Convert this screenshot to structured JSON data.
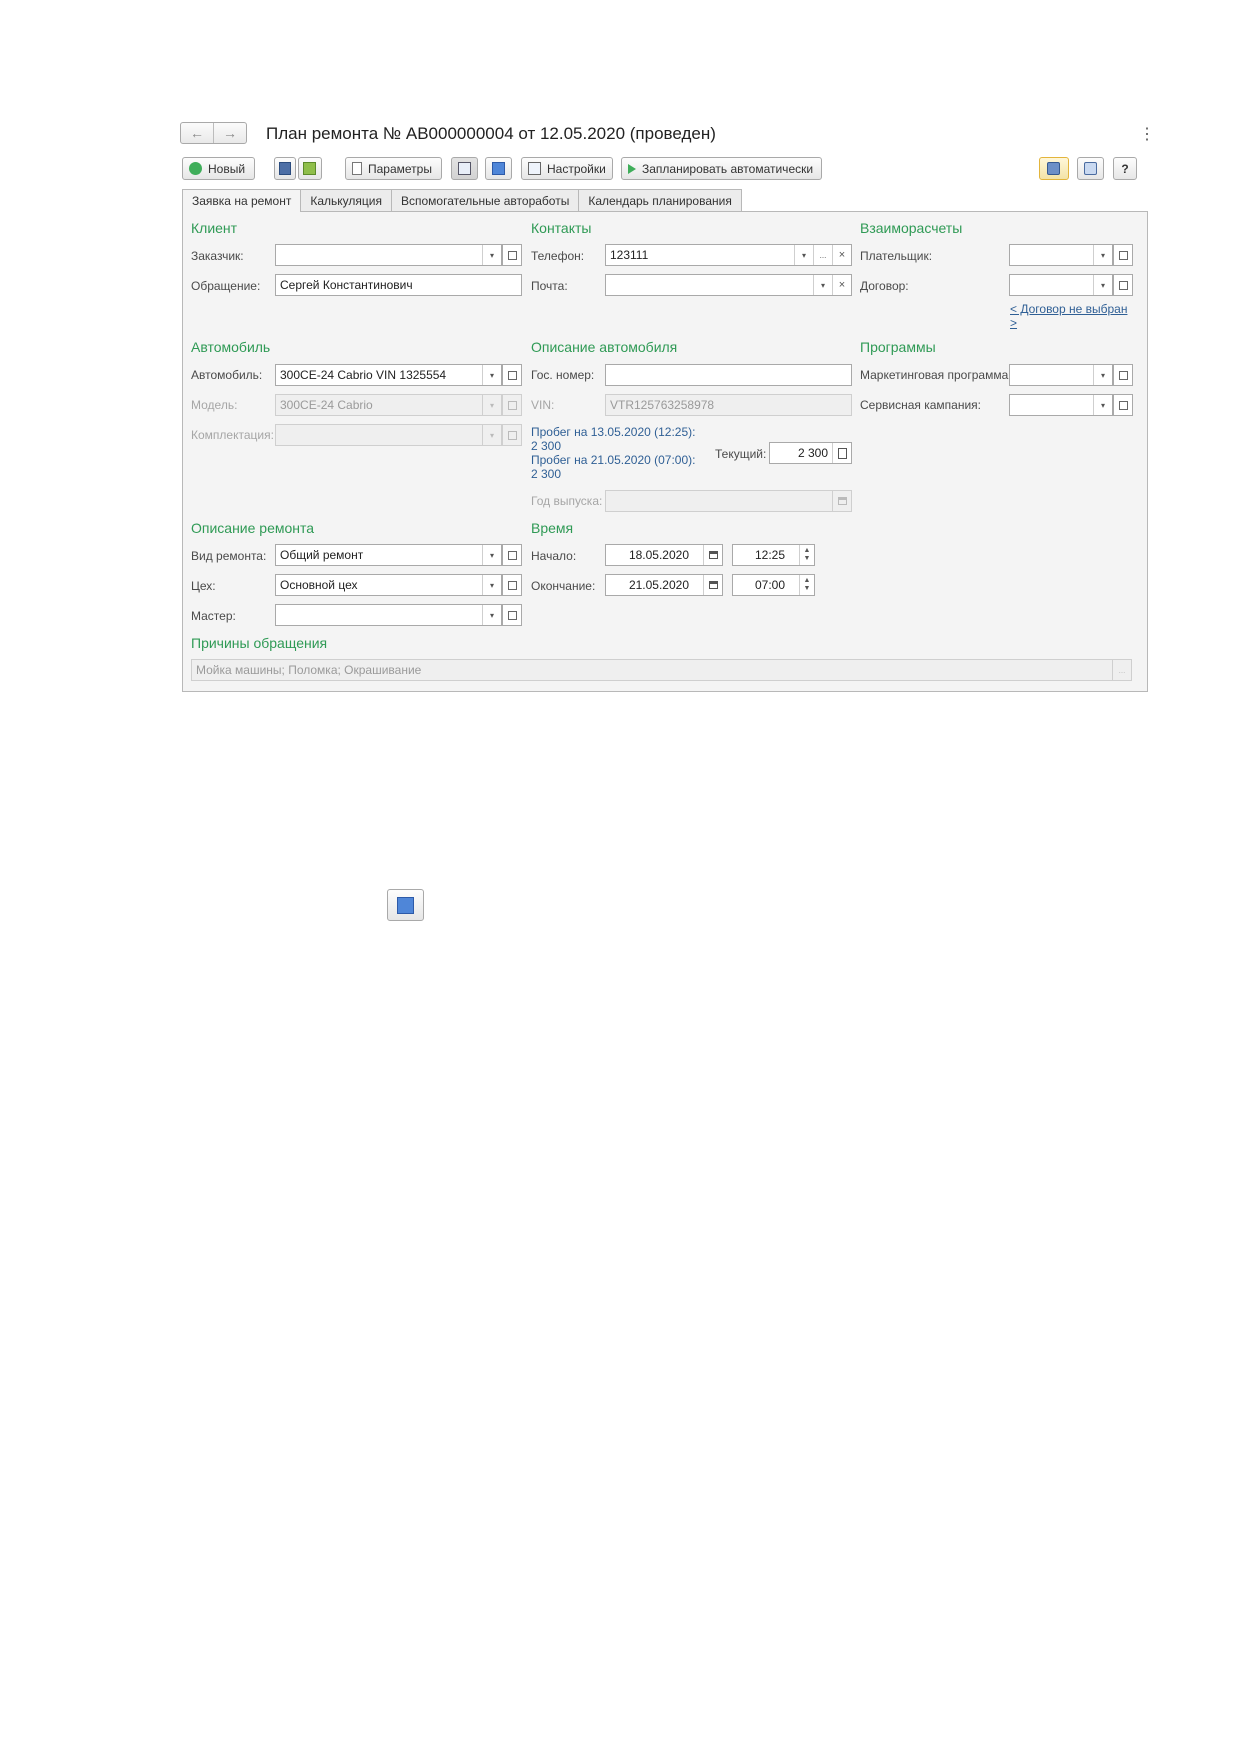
{
  "window": {
    "title": "План ремонта № АВ000000004 от 12.05.2020 (проведен)",
    "back_icon": "←",
    "forward_icon": "→",
    "more_icon": "⋮"
  },
  "toolbar": {
    "new_label": "Новый",
    "params_label": "Параметры",
    "settings_label": "Настройки",
    "plan_auto_label": "Запланировать автоматически",
    "help_label": "?"
  },
  "tabs": [
    {
      "label": "Заявка на ремонт"
    },
    {
      "label": "Калькуляция"
    },
    {
      "label": "Вспомогательные автоработы"
    },
    {
      "label": "Календарь планирования"
    }
  ],
  "client": {
    "section": "Клиент",
    "customer_label": "Заказчик:",
    "customer_value": "",
    "address_label": "Обращение:",
    "address_value": "Сергей Константинович"
  },
  "contacts": {
    "section": "Контакты",
    "phone_label": "Телефон:",
    "phone_value": "123111",
    "email_label": "Почта:",
    "email_value": ""
  },
  "settlements": {
    "section": "Взаиморасчеты",
    "payer_label": "Плательщик:",
    "payer_value": "",
    "contract_label": "Договор:",
    "contract_value": "",
    "contract_link": "< Договор не выбран >"
  },
  "car": {
    "section": "Автомобиль",
    "car_label": "Автомобиль:",
    "car_value": "300CE-24 Cabrio VIN 1325554",
    "model_label": "Модель:",
    "model_value": "300CE-24 Cabrio",
    "equipment_label": "Комплектация:",
    "equipment_value": ""
  },
  "car_description": {
    "section": "Описание автомобиля",
    "plate_label": "Гос. номер:",
    "plate_value": "",
    "vin_label": "VIN:",
    "vin_value": "VTR125763258978",
    "mileage_1": "Пробег на 13.05.2020 (12:25):",
    "mileage_1_value": "2 300",
    "mileage_2": "Пробег на 21.05.2020 (07:00):",
    "mileage_2_value": "2 300",
    "current_label": "Текущий:",
    "current_value": "2 300",
    "year_label": "Год выпуска:",
    "year_value": ""
  },
  "programs": {
    "section": "Программы",
    "marketing_label": "Маркетинговая программа:",
    "marketing_value": "",
    "service_label": "Сервисная кампания:",
    "service_value": ""
  },
  "repair": {
    "section": "Описание ремонта",
    "type_label": "Вид ремонта:",
    "type_value": "Общий ремонт",
    "shop_label": "Цех:",
    "shop_value": "Основной цех",
    "master_label": "Мастер:",
    "master_value": ""
  },
  "time": {
    "section": "Время",
    "start_label": "Начало:",
    "start_date": "18.05.2020",
    "start_time": "12:25",
    "end_label": "Окончание:",
    "end_date": "21.05.2020",
    "end_time": "07:00"
  },
  "reasons": {
    "section": "Причины обращения",
    "value": "Мойка машины; Поломка; Окрашивание",
    "more": "..."
  },
  "dropdown_glyph": "▾",
  "clear_glyph": "×",
  "ellipsis_glyph": "..."
}
